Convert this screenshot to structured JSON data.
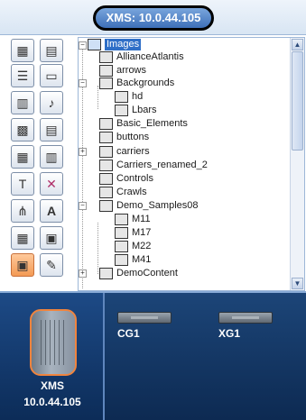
{
  "title": "XMS: 10.0.44.105",
  "tree": {
    "root": "Images",
    "nodes": [
      {
        "label": "AllianceAtlantis"
      },
      {
        "label": "arrows"
      },
      {
        "label": "Backgrounds"
      },
      {
        "label": "hd"
      },
      {
        "label": "Lbars"
      },
      {
        "label": "Basic_Elements"
      },
      {
        "label": "buttons"
      },
      {
        "label": "carriers"
      },
      {
        "label": "Carriers_renamed_2"
      },
      {
        "label": "Controls"
      },
      {
        "label": "Crawls"
      },
      {
        "label": "Demo_Samples08"
      },
      {
        "label": "M11"
      },
      {
        "label": "M17"
      },
      {
        "label": "M22"
      },
      {
        "label": "M41"
      },
      {
        "label": "DemoContent"
      }
    ]
  },
  "toolbar": {
    "icons": [
      "layout-icon",
      "grid-layout-icon",
      "list-icon",
      "monitor-icon",
      "document-icon",
      "music-icon",
      "image-icon",
      "page-icon",
      "form-icon",
      "columns-icon",
      "text-box-icon",
      "delete-icon",
      "network-icon",
      "font-icon",
      "clock-icon",
      "template-icon",
      "display-icon",
      "edit-icon"
    ]
  },
  "xms": {
    "name": "XMS",
    "ip": "10.0.44.105"
  },
  "devices": [
    {
      "label": "CG1"
    },
    {
      "label": "XG1"
    }
  ],
  "colors": {
    "accent": "#2f6fc7",
    "highlight": "#f0843e",
    "panel": "#0d2a52"
  }
}
